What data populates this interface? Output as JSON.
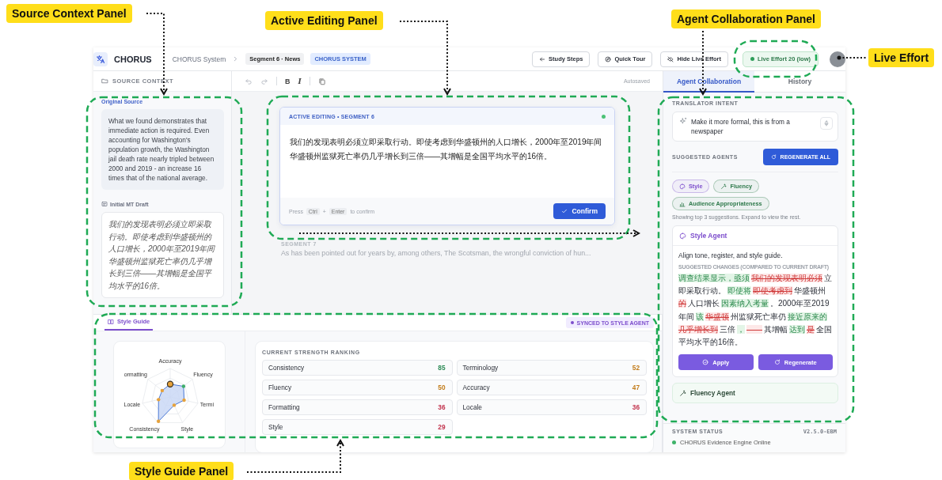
{
  "annotations": {
    "callouts": [
      {
        "label": "Source Context Panel"
      },
      {
        "label": "Active Editing Panel"
      },
      {
        "label": "Agent Collaboration Panel"
      },
      {
        "label": "Live Effort"
      },
      {
        "label": "Style Guide Panel"
      }
    ]
  },
  "topbar": {
    "app_name": "CHORUS",
    "breadcrumb": "CHORUS System",
    "segment_chip": "Segment 6 · News",
    "system_chip": "CHORUS SYSTEM",
    "buttons": [
      {
        "label": "Study Steps",
        "kind": "back"
      },
      {
        "label": "Quick Tour",
        "kind": "tour"
      },
      {
        "label": "Hide Live Effort",
        "kind": "hide"
      }
    ],
    "live_effort": "Live Effort 20 (low)"
  },
  "source_context": {
    "title": "SOURCE CONTEXT",
    "original_label": "Original Source",
    "original_text": "What we found demonstrates that immediate action is required. Even accounting for Washington's population growth, the Washington jail death rate nearly tripled between 2000 and 2019 - an increase 16 times that of the national average.",
    "draft_label": "Initial MT Draft",
    "draft_text": "我们的发现表明必须立即采取行动。即使考虑到华盛顿州的人口增长，2000年至2019年间华盛顿州监狱死亡率仍几乎增长到三倍——其增幅是全国平均水平的16倍。"
  },
  "editor": {
    "format_buttons": [
      "B",
      "I"
    ],
    "autosave": "Autosaved",
    "card_header": "ACTIVE EDITING • SEGMENT 6",
    "text": "我们的发现表明必须立即采取行动。即使考虑到华盛顿州的人口增长，2000年至2019年间华盛顿州监狱死亡率仍几乎增长到三倍——其增幅是全国平均水平的16倍。",
    "hint": {
      "before": "Press",
      "keys": [
        "Ctrl",
        "Enter"
      ],
      "joiner": "+",
      "after": "to confirm"
    },
    "confirm": "Confirm",
    "next_label": "SEGMENT 7",
    "next_text": "As has been pointed out for years by, among others, The Scotsman, the wrongful conviction of hun..."
  },
  "agent_panel": {
    "tabs": [
      {
        "label": "Agent Collaboration",
        "selected": true
      },
      {
        "label": "History",
        "selected": false
      }
    ],
    "intent_label": "TRANSLATOR INTENT",
    "intent_text": "Make it more formal, this is from a newspaper",
    "suggested_label": "SUGGESTED AGENTS",
    "regenerate_all": "REGENERATE ALL",
    "chips": [
      {
        "label": "Style",
        "kind": "style",
        "color": "#7c4dcc"
      },
      {
        "label": "Fluency",
        "kind": "fluency",
        "color": "#2f7a4c"
      },
      {
        "label": "Audience Appropriateness",
        "kind": "audience",
        "color": "#2f7a4c"
      }
    ],
    "note": "Showing top 3 suggestions. Expand to view the rest.",
    "style_agent": {
      "title": "Style Agent",
      "description": "Align tone, register, and style guide.",
      "changes_label": "SUGGESTED CHANGES (COMPARED TO CURRENT DRAFT)",
      "diff": [
        {
          "kind": "ins",
          "text": "调查结果显示，亟须"
        },
        {
          "kind": "del",
          "text": "我们的发现表明必须"
        },
        {
          "kind": "same",
          "text": "立即采取行动。"
        },
        {
          "kind": "ins",
          "text": "即使将"
        },
        {
          "kind": "del",
          "text": "即使考虑到"
        },
        {
          "kind": "same",
          "text": "华盛顿州"
        },
        {
          "kind": "del",
          "text": "的"
        },
        {
          "kind": "same",
          "text": "人口增长"
        },
        {
          "kind": "ins",
          "text": "因素纳入考量"
        },
        {
          "kind": "same",
          "text": "。2000年至2019年间"
        },
        {
          "kind": "ins",
          "text": "该"
        },
        {
          "kind": "del",
          "text": "华盛顿"
        },
        {
          "kind": "same",
          "text": "州监狱死亡率仍"
        },
        {
          "kind": "ins",
          "text": "接近原来的"
        },
        {
          "kind": "del",
          "text": "几乎增长到"
        },
        {
          "kind": "same",
          "text": "三倍"
        },
        {
          "kind": "ins",
          "text": "，"
        },
        {
          "kind": "del",
          "text": "——"
        },
        {
          "kind": "same",
          "text": "其增幅"
        },
        {
          "kind": "ins",
          "text": "达到"
        },
        {
          "kind": "del",
          "text": "是"
        },
        {
          "kind": "same",
          "text": "全国平均水平的16倍。"
        }
      ],
      "buttons": [
        {
          "label": "Apply",
          "kind": "apply"
        },
        {
          "label": "Regenerate",
          "kind": "regenerate"
        }
      ]
    },
    "fluency_agent": {
      "title": "Fluency Agent"
    },
    "status": {
      "label": "SYSTEM STATUS",
      "version": "V2.5.0-EBM",
      "message": "CHORUS Evidence Engine Online"
    }
  },
  "style_guide": {
    "tabs": [
      {
        "label": "Style Guide",
        "selected": true
      }
    ],
    "synced": "SYNCED TO STYLE AGENT",
    "radar_labels": [
      "Accuracy",
      "ormatting",
      "Fluency",
      "Locale",
      "Termi",
      "Consistency",
      "Style"
    ],
    "ranking_title": "CURRENT STRENGTH RANKING",
    "ranking": [
      {
        "name": "Consistency",
        "score": "85",
        "color": "#2e8b57"
      },
      {
        "name": "Terminology",
        "score": "52",
        "color": "#c27c1a"
      },
      {
        "name": "Fluency",
        "score": "50",
        "color": "#c27c1a"
      },
      {
        "name": "Accuracy",
        "score": "47",
        "color": "#c27c1a"
      },
      {
        "name": "Formatting",
        "score": "36",
        "color": "#c2334d"
      },
      {
        "name": "Locale",
        "score": "36",
        "color": "#c2334d"
      },
      {
        "name": "Style",
        "score": "29",
        "color": "#c2334d"
      }
    ]
  }
}
